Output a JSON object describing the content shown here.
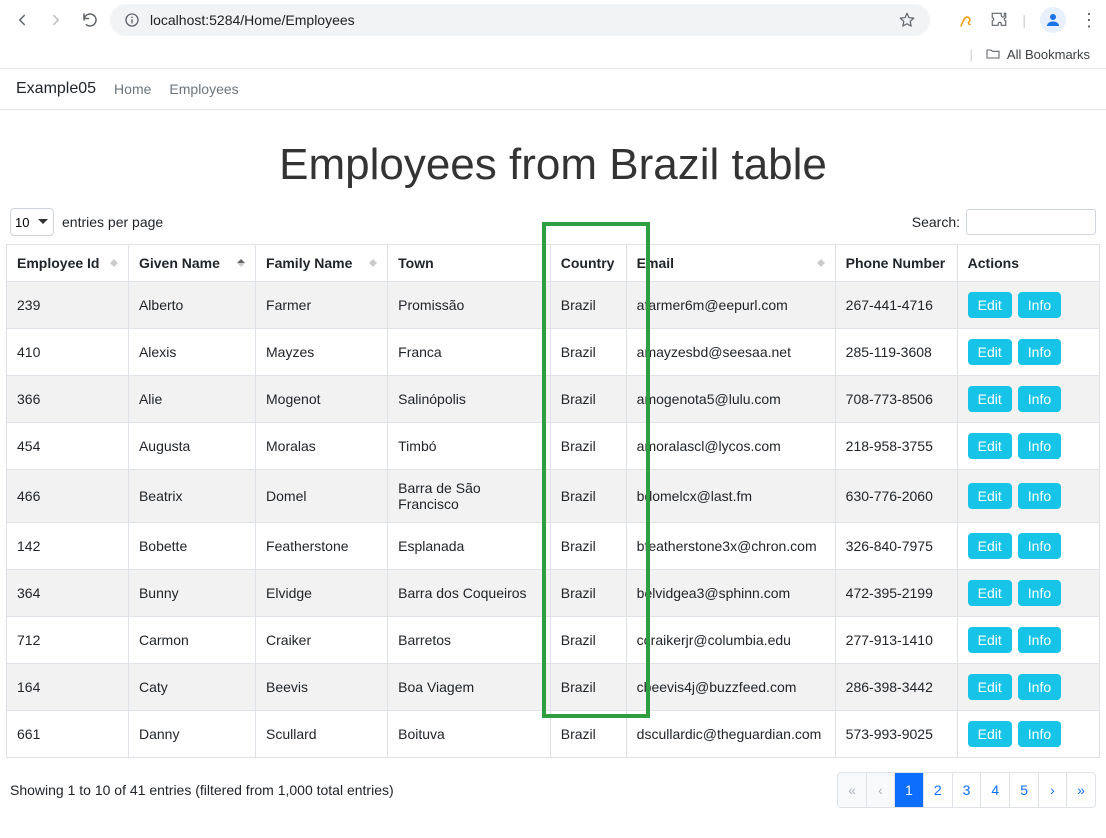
{
  "browser": {
    "url": "localhost:5284/Home/Employees"
  },
  "bookmarks_bar": {
    "all_bookmarks": "All Bookmarks"
  },
  "navbar": {
    "brand": "Example05",
    "links": [
      "Home",
      "Employees"
    ]
  },
  "page_title": "Employees from Brazil table",
  "length_control": {
    "value": "10",
    "label": "entries per page"
  },
  "search": {
    "label": "Search:",
    "value": ""
  },
  "columns": [
    {
      "key": "id",
      "label": "Employee Id",
      "sortable": true
    },
    {
      "key": "given",
      "label": "Given Name",
      "sortable": true,
      "sorted": "asc"
    },
    {
      "key": "family",
      "label": "Family Name",
      "sortable": true
    },
    {
      "key": "town",
      "label": "Town",
      "sortable": false
    },
    {
      "key": "country",
      "label": "Country",
      "sortable": false
    },
    {
      "key": "email",
      "label": "Email",
      "sortable": true
    },
    {
      "key": "phone",
      "label": "Phone Number",
      "sortable": false
    },
    {
      "key": "actions",
      "label": "Actions",
      "sortable": false
    }
  ],
  "rows": [
    {
      "id": "239",
      "given": "Alberto",
      "family": "Farmer",
      "town": "Promissão",
      "country": "Brazil",
      "email": "afarmer6m@eepurl.com",
      "phone": "267-441-4716"
    },
    {
      "id": "410",
      "given": "Alexis",
      "family": "Mayzes",
      "town": "Franca",
      "country": "Brazil",
      "email": "amayzesbd@seesaa.net",
      "phone": "285-119-3608"
    },
    {
      "id": "366",
      "given": "Alie",
      "family": "Mogenot",
      "town": "Salinópolis",
      "country": "Brazil",
      "email": "amogenota5@lulu.com",
      "phone": "708-773-8506"
    },
    {
      "id": "454",
      "given": "Augusta",
      "family": "Moralas",
      "town": "Timbó",
      "country": "Brazil",
      "email": "amoralascl@lycos.com",
      "phone": "218-958-3755"
    },
    {
      "id": "466",
      "given": "Beatrix",
      "family": "Domel",
      "town": "Barra de São Francisco",
      "country": "Brazil",
      "email": "bdomelcx@last.fm",
      "phone": "630-776-2060"
    },
    {
      "id": "142",
      "given": "Bobette",
      "family": "Featherstone",
      "town": "Esplanada",
      "country": "Brazil",
      "email": "bfeatherstone3x@chron.com",
      "phone": "326-840-7975"
    },
    {
      "id": "364",
      "given": "Bunny",
      "family": "Elvidge",
      "town": "Barra dos Coqueiros",
      "country": "Brazil",
      "email": "belvidgea3@sphinn.com",
      "phone": "472-395-2199"
    },
    {
      "id": "712",
      "given": "Carmon",
      "family": "Craiker",
      "town": "Barretos",
      "country": "Brazil",
      "email": "ccraikerjr@columbia.edu",
      "phone": "277-913-1410"
    },
    {
      "id": "164",
      "given": "Caty",
      "family": "Beevis",
      "town": "Boa Viagem",
      "country": "Brazil",
      "email": "cbeevis4j@buzzfeed.com",
      "phone": "286-398-3442"
    },
    {
      "id": "661",
      "given": "Danny",
      "family": "Scullard",
      "town": "Boituva",
      "country": "Brazil",
      "email": "dscullardic@theguardian.com",
      "phone": "573-993-9025"
    }
  ],
  "actions": {
    "edit": "Edit",
    "info": "Info"
  },
  "footer_info": "Showing 1 to 10 of 41 entries (filtered from 1,000 total entries)",
  "pagination": {
    "prev_first": "«",
    "prev": "‹",
    "next": "›",
    "next_last": "»",
    "pages": [
      "1",
      "2",
      "3",
      "4",
      "5"
    ],
    "active": "1"
  }
}
